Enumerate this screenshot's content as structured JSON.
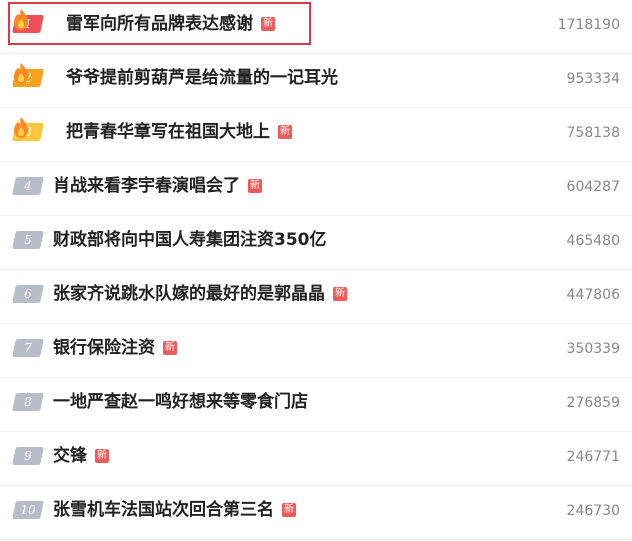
{
  "colors": {
    "rank_1": "#f0505a",
    "rank_2": "#f7a11c",
    "rank_3": "#ffc63b",
    "rank_other": "#b8bcc8",
    "new_tag": "#ef5a5a",
    "highlight_border": "#d73a4a",
    "flame": "#ff8a1f"
  },
  "icons": {
    "flame": "flame-icon",
    "new": "new-tag-icon"
  },
  "items": [
    {
      "rank": "1",
      "title": "雷军向所有品牌表达感谢",
      "is_new": true,
      "new_label": "新",
      "count": "1718190"
    },
    {
      "rank": "2",
      "title": "爷爷提前剪葫芦是给流量的一记耳光",
      "is_new": false,
      "new_label": "",
      "count": "953334"
    },
    {
      "rank": "3",
      "title": "把青春华章写在祖国大地上",
      "is_new": true,
      "new_label": "新",
      "count": "758138"
    },
    {
      "rank": "4",
      "title": "肖战来看李宇春演唱会了",
      "is_new": true,
      "new_label": "新",
      "count": "604287"
    },
    {
      "rank": "5",
      "title": "财政部将向中国人寿集团注资350亿",
      "is_new": false,
      "new_label": "",
      "count": "465480"
    },
    {
      "rank": "6",
      "title": "张家齐说跳水队嫁的最好的是郭晶晶",
      "is_new": true,
      "new_label": "新",
      "count": "447806"
    },
    {
      "rank": "7",
      "title": "银行保险注资",
      "is_new": true,
      "new_label": "新",
      "count": "350339"
    },
    {
      "rank": "8",
      "title": "一地严查赵一鸣好想来等零食门店",
      "is_new": false,
      "new_label": "",
      "count": "276859"
    },
    {
      "rank": "9",
      "title": "交锋",
      "is_new": true,
      "new_label": "新",
      "count": "246771"
    },
    {
      "rank": "10",
      "title": "张雪机车法国站次回合第三名",
      "is_new": true,
      "new_label": "新",
      "count": "246730"
    }
  ]
}
